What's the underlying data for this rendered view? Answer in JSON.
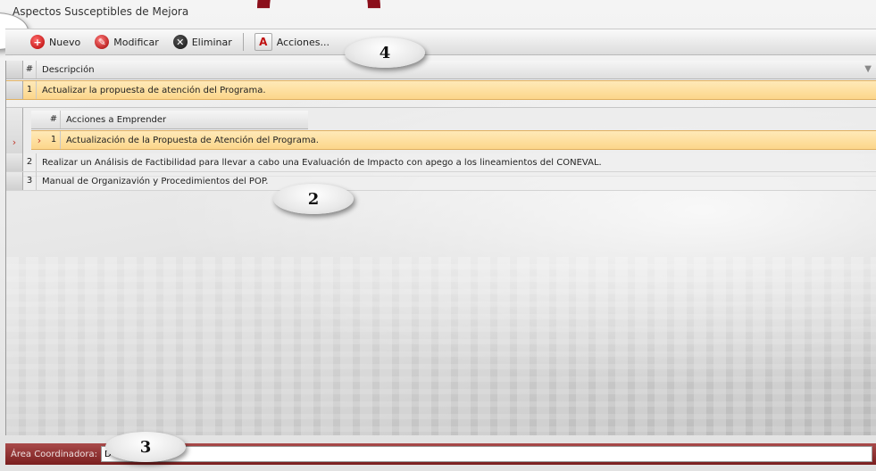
{
  "window": {
    "title": "Aspectos Susceptibles de Mejora"
  },
  "toolbar": {
    "buttons": [
      {
        "label": "Nuevo",
        "icon": "add-circle-icon"
      },
      {
        "label": "Modificar",
        "icon": "edit-circle-icon"
      },
      {
        "label": "Eliminar",
        "icon": "delete-circle-icon"
      },
      {
        "label": "Acciones...",
        "icon": "actions-icon"
      }
    ]
  },
  "grid": {
    "columns": {
      "num": "#",
      "description": "Descripción"
    },
    "rows": [
      {
        "num": "1",
        "description": "Actualizar la propuesta de atención del Programa."
      },
      {
        "num": "2",
        "description": "Realizar un Análisis de Factibilidad para llevar a cabo una Evaluación de Impacto con apego a los lineamientos del CONEVAL."
      },
      {
        "num": "3",
        "description": "Manual de Organizavión y Procedimientos del POP."
      }
    ],
    "subgrid": {
      "columns": {
        "num": "#",
        "actions": "Acciones a Emprender"
      },
      "rows": [
        {
          "num": "1",
          "action": "Actualización de la Propuesta de Atención del Programa."
        }
      ]
    }
  },
  "footer": {
    "area_label": "Área Coordinadora:",
    "area_value": "D"
  },
  "callouts": {
    "c2": "2",
    "c3": "3",
    "c4": "4"
  },
  "colors": {
    "highlight": "#fcd68a",
    "accent": "#8b0e1a",
    "footer": "#7a1f1f"
  }
}
